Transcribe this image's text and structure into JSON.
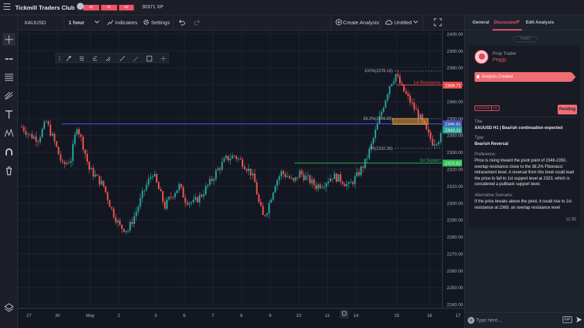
{
  "app": {
    "title": "Tickmill Traders Club",
    "xp_segments": [
      "40",
      "41",
      "42"
    ],
    "xp_progress": 0.7,
    "xp_text": "30371 XP"
  },
  "toolbar": {
    "symbol": "XAUUSD",
    "interval": "1 hour",
    "indicators_label": "Indicators",
    "settings_label": "Settings",
    "create_analysis_label": "Create Analysis",
    "layout_name": "Untitled"
  },
  "chart_data": {
    "type": "candlestick",
    "symbol": "XAUUSD",
    "interval": "1 hour",
    "ylim": [
      2238,
      2402
    ],
    "y_ticks": [
      2400,
      2390,
      2380,
      2370,
      2360,
      2350,
      2340,
      2330,
      2320,
      2310,
      2300,
      2290,
      2280,
      2270,
      2260,
      2250,
      2240
    ],
    "x_ticks": [
      "27",
      "30",
      "May",
      "2",
      "3",
      "6",
      "7",
      "8",
      "9",
      "10",
      "11",
      "14",
      "15",
      "16",
      "17"
    ],
    "close_path": [
      [
        0,
        2345
      ],
      [
        4,
        2340
      ],
      [
        8,
        2338
      ],
      [
        12,
        2348
      ],
      [
        16,
        2336
      ],
      [
        20,
        2322
      ],
      [
        24,
        2326
      ],
      [
        27,
        2346
      ],
      [
        30,
        2334
      ],
      [
        33,
        2320
      ],
      [
        36,
        2316
      ],
      [
        40,
        2310
      ],
      [
        44,
        2296
      ],
      [
        48,
        2286
      ],
      [
        52,
        2284
      ],
      [
        56,
        2295
      ],
      [
        60,
        2308
      ],
      [
        64,
        2318
      ],
      [
        67,
        2308
      ],
      [
        70,
        2298
      ],
      [
        73,
        2304
      ],
      [
        77,
        2310
      ],
      [
        80,
        2302
      ],
      [
        84,
        2300
      ],
      [
        88,
        2305
      ],
      [
        92,
        2312
      ],
      [
        96,
        2320
      ],
      [
        100,
        2326
      ],
      [
        104,
        2328
      ],
      [
        108,
        2324
      ],
      [
        112,
        2318
      ],
      [
        114,
        2312
      ],
      [
        116,
        2300
      ],
      [
        118,
        2292
      ],
      [
        120,
        2296
      ],
      [
        124,
        2312
      ],
      [
        127,
        2318
      ],
      [
        130,
        2316
      ],
      [
        133,
        2312
      ],
      [
        136,
        2318
      ],
      [
        140,
        2314
      ],
      [
        144,
        2310
      ],
      [
        148,
        2312
      ],
      [
        152,
        2316
      ],
      [
        156,
        2314
      ],
      [
        160,
        2310
      ],
      [
        164,
        2316
      ],
      [
        168,
        2324
      ],
      [
        171,
        2334
      ],
      [
        174,
        2346
      ],
      [
        177,
        2358
      ],
      [
        180,
        2370
      ],
      [
        183,
        2376
      ],
      [
        186,
        2368
      ],
      [
        189,
        2362
      ],
      [
        192,
        2356
      ],
      [
        195,
        2350
      ],
      [
        198,
        2342
      ],
      [
        201,
        2336
      ],
      [
        204,
        2338
      ],
      [
        207,
        2342
      ]
    ],
    "fibonacci": [
      {
        "label": "100%(2378.16)",
        "value": 2378.16
      },
      {
        "label": "38.2%(2349.85)",
        "value": 2349.85
      },
      {
        "label": "0%(2332.36)",
        "value": 2332.36
      }
    ],
    "levels": [
      {
        "label": "1st Resistance",
        "value": 2369.71,
        "color": "#e84a4a"
      },
      {
        "label": "1st Support",
        "value": 2323.62,
        "color": "#2ebd55"
      },
      {
        "label": "",
        "value": 2346.81,
        "color": "#4a5cff"
      }
    ],
    "zone": {
      "low": 2346.5,
      "high": 2350.0,
      "color": "#f0a030"
    },
    "price_labels": [
      {
        "text": "2369.71",
        "value": 2369.71,
        "color": "#e84a4a"
      },
      {
        "text": "2346.81",
        "value": 2346.81,
        "color": "#3f51b5"
      },
      {
        "text": "2343.21",
        "value": 2343.21,
        "color": "#26a69a"
      },
      {
        "text": "2323.62",
        "value": 2323.62,
        "color": "#2ebd55"
      }
    ],
    "arrow": {
      "from": 2346,
      "to": 2323
    }
  },
  "panel": {
    "tabs": [
      "General",
      "Discussion",
      "Edit Analysis"
    ],
    "active_tab_close": "×",
    "pill": "Trader",
    "role": "Prop Trader",
    "author": "Peggy",
    "status_event": "Analysis Created",
    "tags": [
      "XAUUSD",
      "H1"
    ],
    "status": "Pending",
    "title_label": "Title",
    "title_value": "XAUUSD H1 | Bearish continuation expected",
    "type_label": "Type",
    "type_value": "Bearish Reversal",
    "preference_label": "Preference:",
    "preference_value": "Price is rising toward the pivot point of 2346-2350, overlap resistance close to the 38.2% Fibonacci retracement level. A reversal from this level could lead the price to fall to 1st  support level at 2323, which is considered a pullback support level.",
    "alt_label": "Alternative Scenario:",
    "alt_value": "If the price breaks above the pivot, it could rise to 1st resistance at 2369, an overlap resistance level",
    "time": "11:35",
    "input_placeholder": "Type here...",
    "gif_label": "GIF"
  }
}
